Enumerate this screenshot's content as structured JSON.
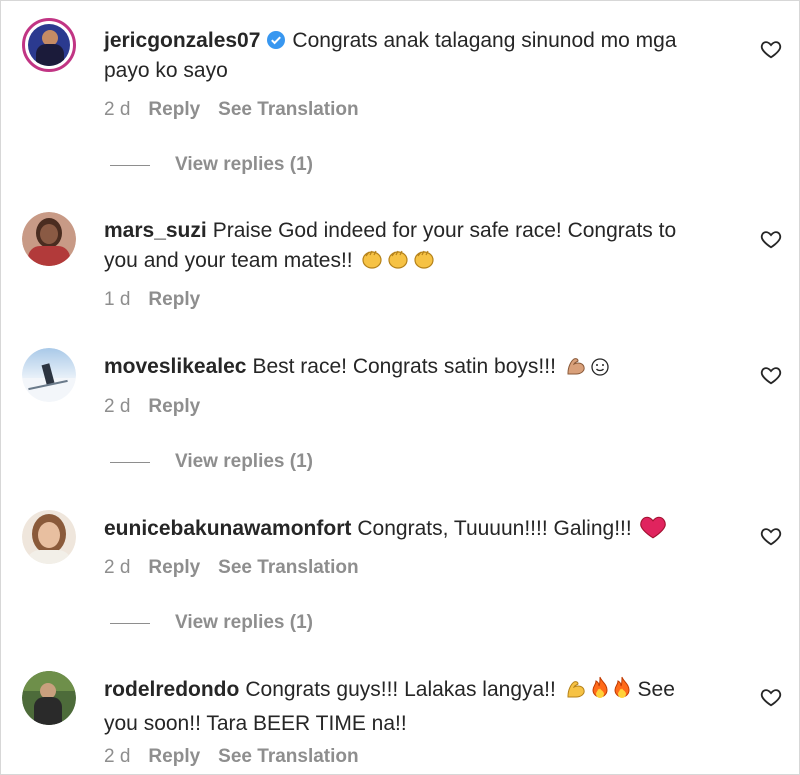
{
  "comments": [
    {
      "username": "jericgonzales07",
      "verified": true,
      "text": "Congrats anak talagang sinunod mo mga payo ko sayo",
      "time": "2 d",
      "reply_label": "Reply",
      "translation_label": "See Translation",
      "view_replies": "View replies (1)"
    },
    {
      "username": "mars_suzi",
      "text": "Praise God indeed for your safe race! Congrats to you and your team mates!!",
      "emojis": [
        "clapping-hands",
        "clapping-hands",
        "clapping-hands"
      ],
      "time": "1 d",
      "reply_label": "Reply"
    },
    {
      "username": "moveslikealec",
      "text": "Best race! Congrats satin boys!!!",
      "emojis": [
        "flexed-biceps",
        "smiling-face"
      ],
      "time": "2 d",
      "reply_label": "Reply",
      "view_replies": "View replies (1)"
    },
    {
      "username": "eunicebakunawamonfort",
      "text": "Congrats, Tuuuun!!!! Galing!!!",
      "emojis": [
        "red-heart"
      ],
      "time": "2 d",
      "reply_label": "Reply",
      "translation_label": "See Translation",
      "view_replies": "View replies (1)"
    },
    {
      "username": "rodelredondo",
      "text": "Congrats guys!!! Lalakas langya!!",
      "text_after_emojis": "See you soon!! Tara BEER TIME na!!",
      "emojis": [
        "flexed-biceps",
        "fire",
        "fire"
      ],
      "time": "2 d",
      "reply_label": "Reply",
      "translation_label": "See Translation"
    }
  ],
  "colors": {
    "text": "#262626",
    "secondary": "#8e8e8e",
    "verified": "#3897f0",
    "heart_red": "#ed4956"
  }
}
